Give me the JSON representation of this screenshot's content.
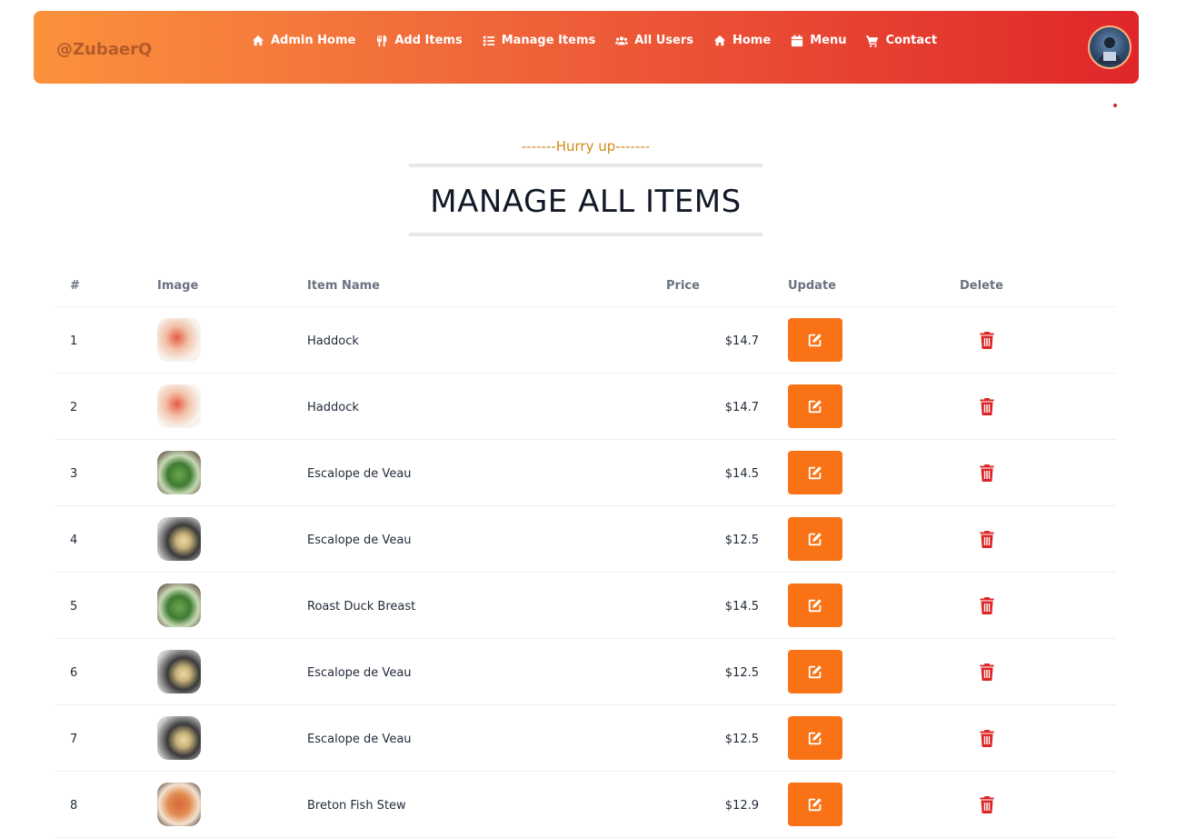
{
  "brand": "@ZubaerQ",
  "nav": [
    {
      "label": "Admin Home",
      "icon": "home-icon"
    },
    {
      "label": "Add Items",
      "icon": "utensils-icon"
    },
    {
      "label": "Manage Items",
      "icon": "list-icon"
    },
    {
      "label": "All Users",
      "icon": "users-icon"
    },
    {
      "label": "Home",
      "icon": "home-icon"
    },
    {
      "label": "Menu",
      "icon": "calendar-icon"
    },
    {
      "label": "Contact",
      "icon": "cart-icon"
    }
  ],
  "section": {
    "subheading": "-------Hurry up-------",
    "heading": "MANAGE ALL ITEMS"
  },
  "table": {
    "headers": {
      "index": "#",
      "image": "Image",
      "name": "Item Name",
      "price": "Price",
      "update": "Update",
      "delete": "Delete"
    },
    "rows": [
      {
        "index": "1",
        "name": "Haddock",
        "price": "$14.7",
        "thumb": "fish"
      },
      {
        "index": "2",
        "name": "Haddock",
        "price": "$14.7",
        "thumb": "fish"
      },
      {
        "index": "3",
        "name": "Escalope de Veau",
        "price": "$14.5",
        "thumb": "salad"
      },
      {
        "index": "4",
        "name": "Escalope de Veau",
        "price": "$12.5",
        "thumb": "plate"
      },
      {
        "index": "5",
        "name": "Roast Duck Breast",
        "price": "$14.5",
        "thumb": "salad"
      },
      {
        "index": "6",
        "name": "Escalope de Veau",
        "price": "$12.5",
        "thumb": "plate"
      },
      {
        "index": "7",
        "name": "Escalope de Veau",
        "price": "$12.5",
        "thumb": "plate"
      },
      {
        "index": "8",
        "name": "Breton Fish Stew",
        "price": "$12.9",
        "thumb": "stew"
      }
    ]
  },
  "colors": {
    "accent": "#f97316",
    "delete": "#dc2626",
    "subheading": "#d08a1a"
  }
}
